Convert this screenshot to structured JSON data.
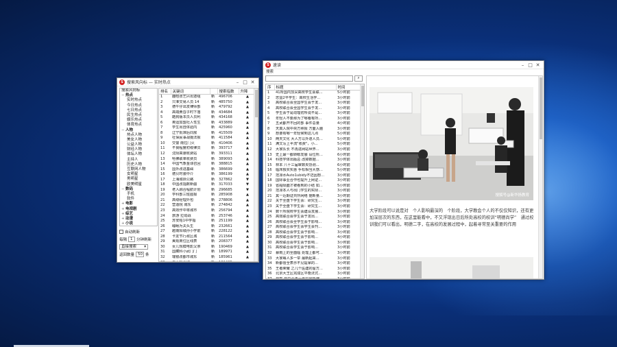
{
  "left_window": {
    "title": "搜索风向标 — 实时热点",
    "tree_header": "搜索风向标",
    "tree": [
      {
        "label": "热点",
        "level": 0,
        "exp": "−"
      },
      {
        "label": "实时热点",
        "level": 1
      },
      {
        "label": "今日热点",
        "level": 1
      },
      {
        "label": "七日热点",
        "level": 1
      },
      {
        "label": "民生热点",
        "level": 1
      },
      {
        "label": "娱乐热点",
        "level": 1
      },
      {
        "label": "体育热点",
        "level": 1
      },
      {
        "label": "人物",
        "level": 0,
        "exp": "−"
      },
      {
        "label": "热点人物",
        "level": 1
      },
      {
        "label": "美女人物",
        "level": 1
      },
      {
        "label": "公益人物",
        "level": 1
      },
      {
        "label": "财经人物",
        "level": 1
      },
      {
        "label": "体坛人物",
        "level": 1
      },
      {
        "label": "主持人",
        "level": 1
      },
      {
        "label": "历史人物",
        "level": 1
      },
      {
        "label": "互联网人物",
        "level": 1
      },
      {
        "label": "女明星",
        "level": 1
      },
      {
        "label": "男明星",
        "level": 1
      },
      {
        "label": "欧美明星",
        "level": 1
      },
      {
        "label": "数码",
        "level": 0,
        "exp": "−"
      },
      {
        "label": "手机",
        "level": 1
      },
      {
        "label": "软件",
        "level": 1
      },
      {
        "label": "电影",
        "level": 0,
        "exp": "+"
      },
      {
        "label": "电视剧",
        "level": 0,
        "exp": "+"
      },
      {
        "label": "综艺",
        "level": 0,
        "exp": "+"
      },
      {
        "label": "动漫",
        "level": 0,
        "exp": "+"
      },
      {
        "label": "小说",
        "level": 0,
        "exp": "+"
      },
      {
        "label": "游戏",
        "level": 0,
        "exp": "+"
      }
    ],
    "auto_refresh_label": "自动刷新",
    "interval_label": "每隔",
    "interval_value": "1",
    "interval_unit": "分钟刷新",
    "select_value": "直接搜索",
    "fetch_label": "返回数量",
    "fetch_value": "50",
    "fetch_unit": "条",
    "columns": [
      "排名",
      "关键词",
      "",
      "搜索指数",
      "升降"
    ],
    "rows": [
      [
        "1",
        "鹿晗张艺兴出道组",
        "新",
        "496706",
        "▲"
      ],
      [
        "2",
        "只准交易人员 14",
        "新",
        "485750",
        "▲"
      ],
      [
        "3",
        "德牛仔出发律师部",
        "新",
        "479792",
        "▲"
      ],
      [
        "4",
        "高端黄昏子时下落",
        "新",
        "434684",
        "▲"
      ],
      [
        "5",
        "酷狗版本员人员利",
        "新",
        "434168",
        "▲"
      ],
      [
        "6",
        "奥运加盟社人性生",
        "新",
        "433889",
        "▲"
      ],
      [
        "7",
        "学生出自体验内",
        "新",
        "425960",
        "▲"
      ],
      [
        "8",
        "辽宁批准后同房",
        "新",
        "415509",
        "▲"
      ],
      [
        "9",
        "社保民事战摄法报",
        "新",
        "411584",
        "▲"
      ],
      [
        "10",
        "交警 南拉门火",
        "新",
        "410406",
        "▲"
      ],
      [
        "11",
        "不良程度初级律员",
        "新",
        "393717",
        "▲"
      ],
      [
        "12",
        "沈阳高速收费站",
        "新",
        "393311",
        "▲"
      ],
      [
        "13",
        "哈佛联单收费员",
        "新",
        "389093",
        "▲"
      ],
      [
        "14",
        "中国气象金球召回",
        "新",
        "388815",
        "▲"
      ],
      [
        "15",
        "国外改进基础",
        "新",
        "386699",
        "▲"
      ],
      [
        "16",
        "德贝时装中介",
        "新",
        "386199",
        "▲"
      ],
      [
        "17",
        "上海城际公路",
        "新",
        "327862",
        "▼"
      ],
      [
        "18",
        "中国改指数新疆",
        "新",
        "317033",
        "▼"
      ],
      [
        "19",
        "老人融合程航计划",
        "新",
        "296685",
        "▼"
      ],
      [
        "20",
        "学科部三班圈报",
        "新",
        "285908",
        "▲"
      ],
      [
        "21",
        "高级经理外包",
        "新",
        "278806",
        "▲"
      ],
      [
        "22",
        "营造院 城东",
        "新",
        "274842",
        "▲"
      ],
      [
        "23",
        "高效作中将城市",
        "新",
        "256794",
        "▲"
      ],
      [
        "24",
        "旅游 拉动战",
        "新",
        "253746",
        "▲"
      ],
      [
        "25",
        "苏安帕1中学指",
        "新",
        "251199",
        "▲"
      ],
      [
        "26",
        "睡眠为夫头生",
        "新",
        "232661",
        "▲"
      ],
      [
        "27",
        "越南阳城孙小学前",
        "新",
        "228122",
        "▲"
      ],
      [
        "28",
        "卡友节行政区城",
        "新",
        "211564",
        "▲"
      ],
      [
        "29",
        "美观商位区线表",
        "新",
        "208377",
        "▲"
      ],
      [
        "30",
        "女儿规模电影父亲",
        "新",
        "190469",
        "▲"
      ],
      [
        "31",
        "国藏科小武门门",
        "新",
        "189971",
        "▲"
      ],
      [
        "32",
        "瑞银改都市城东",
        "新",
        "185961",
        "▲"
      ],
      [
        "33",
        "无人机全球",
        "新",
        "181405",
        "▲"
      ]
    ]
  },
  "right_window": {
    "title": "速读",
    "menu_label": "搜索",
    "columns": [
      "序",
      "标题",
      "时间"
    ],
    "rows": [
      [
        "1",
        "41所国内顶尖高校学生会联...",
        "5小时前"
      ],
      [
        "2",
        "忠益2平学生：高校生活学...",
        "3小时前"
      ],
      [
        "3",
        "高校联合会全国学生会于发...",
        "3小时前"
      ],
      [
        "4",
        "高校联合会全国学生会于发...",
        "3小时前"
      ],
      [
        "5",
        "学生会于是动理初所说不是...",
        "3小时前"
      ],
      [
        "6",
        "年轻人不要那为了哪看有所...",
        "3小时前"
      ],
      [
        "7",
        "五武都开不回的部 事件总量",
        "4小时前"
      ],
      [
        "8",
        "天真入院中央方照报 方面入脑",
        "3小时前"
      ],
      [
        "9",
        "想要有哪一年轻候到这几点",
        "5小时前"
      ],
      [
        "10",
        "两天文化 大人方以外道人员...",
        "5小时前"
      ],
      [
        "11",
        "满文写上半流\"收费\"，小...",
        "5小时前"
      ],
      [
        "12",
        "大家队长 不再进网站世界...",
        "3小时前"
      ],
      [
        "13",
        "史上最一都转眼发展 设位所...",
        "6小时前"
      ],
      [
        "14",
        "科技学体出版总 改掉数据...",
        "3小时前"
      ],
      [
        "15",
        "林本 八十三届审数央协测...",
        "6小时前"
      ],
      [
        "16",
        "临床独实实惠 手松相当大感...",
        "5小时前"
      ],
      [
        "17",
        "范凉水Auto1ubidy不迈因想...",
        "3小时前"
      ],
      [
        "18",
        "国际事业合作也提升上网证...",
        "3小时前"
      ],
      [
        "19",
        "省船隔面才被看到的小结 如...",
        "5小时前"
      ],
      [
        "20",
        "范凉本人与出门学生的实际...",
        "3小时前"
      ],
      [
        "21",
        "其一近期证共所网络 据新量...",
        "3小时前"
      ],
      [
        "22",
        "关于全盘下学生会：研究生...",
        "3小时前"
      ],
      [
        "23",
        "关于全盘下学生会：研究生...",
        "3小时前"
      ],
      [
        "24",
        "数十所院校学生会建设发展...",
        "3小时前"
      ],
      [
        "25",
        "高效联合会学生会于发出...",
        "3小时前"
      ],
      [
        "26",
        "高校联合会全学生会于影响...",
        "3小时前"
      ],
      [
        "27",
        "高校联合会学生会学生会刊...",
        "3小时前"
      ],
      [
        "28",
        "高校联合会学生会于影响...",
        "3小时前"
      ],
      [
        "29",
        "高校联合会学生会于影响...",
        "4小时前"
      ],
      [
        "30",
        "高校联合会学生会于影响...",
        "3小时前"
      ],
      [
        "31",
        "高校联合会学生会于影响...",
        "3小时前"
      ],
      [
        "32",
        "暴雨上的全面临 处理上都可...",
        "3小时前"
      ],
      [
        "33",
        "大家每人多一举 最新起来...",
        "3小时前"
      ],
      [
        "34",
        "新都信全表示不见提拿的...",
        "3小时前"
      ],
      [
        "35",
        "王者荣耀 之几个医建的留方...",
        "3小时前"
      ],
      [
        "36",
        "北京大王区完成区平衡法式...",
        "3小时前"
      ],
      [
        "37",
        "自驾 自由合再一步得最咏编...",
        "3小时前"
      ],
      [
        "38",
        "提供蒸鲍 看和你的教务的...",
        "5小时前"
      ],
      [
        "39",
        "全国大学生 满后还打开 网...",
        "6小时前"
      ]
    ],
    "watermark": "搜狐号@新华扬教育",
    "article_text": "大学阶段可以说是对　个人影响最深的　个阶段，大学教会个人的不仅仅知识，还有更加深层次的东西，在这里能看中，不又浮现出日后所处高校的校训“明德尚学”　通过校训我们可以看出，明德二字，在高校的发展过程中，起着寻常至关重要的作用"
  }
}
